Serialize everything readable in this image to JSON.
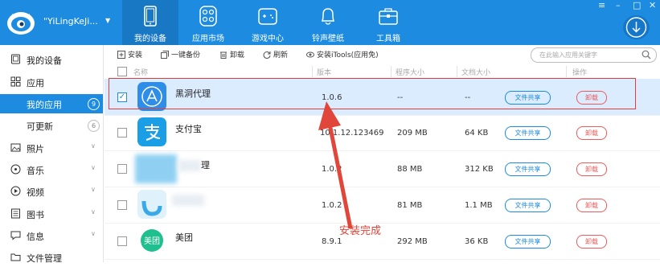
{
  "header": {
    "username": "\"YiLingKeJi...",
    "nav": [
      {
        "label": "我的设备",
        "icon": "tablet-icon",
        "active": true
      },
      {
        "label": "应用市场",
        "icon": "apps-grid-icon",
        "active": false
      },
      {
        "label": "游戏中心",
        "icon": "gamepad-icon",
        "active": false
      },
      {
        "label": "铃声壁纸",
        "icon": "bell-icon",
        "active": false
      },
      {
        "label": "工具箱",
        "icon": "toolbox-icon",
        "active": false
      }
    ],
    "window_controls": {
      "menu": "≡",
      "minimize": "–",
      "maximize": "□",
      "close": "✕"
    }
  },
  "toolbar": {
    "install": "安装",
    "backup": "一键备份",
    "uninstall": "卸载",
    "refresh": "刷新",
    "install_itools": "安装iTools(应用免)",
    "search_placeholder": "在此输入应用关键字"
  },
  "sidebar": {
    "items": [
      {
        "label": "我的设备",
        "icon": "device-icon"
      },
      {
        "label": "应用",
        "icon": "apps-icon"
      },
      {
        "label": "我的应用",
        "badge": "9",
        "active": true
      },
      {
        "label": "可更新",
        "badge": "6"
      },
      {
        "label": "照片",
        "icon": "photo-icon"
      },
      {
        "label": "音乐",
        "icon": "music-icon"
      },
      {
        "label": "视频",
        "icon": "video-icon"
      },
      {
        "label": "图书",
        "icon": "book-icon"
      },
      {
        "label": "信息",
        "icon": "message-icon"
      },
      {
        "label": "文件管理",
        "icon": "folder-icon"
      }
    ]
  },
  "table": {
    "columns": {
      "name": "名称",
      "version": "版本",
      "program_size": "程序大小",
      "doc_size": "文档大小",
      "action": "操作"
    },
    "share_label": "文件共享",
    "uninstall_label": "卸载",
    "rows": [
      {
        "name": "黑洞代理",
        "version": "1.0.6",
        "program_size": "--",
        "doc_size": "--",
        "selected": true
      },
      {
        "name": "支付宝",
        "version": "10.1.12.123469",
        "program_size": "209 MB",
        "doc_size": "64 KB",
        "selected": false
      },
      {
        "name": "理",
        "version": "1.0.2",
        "program_size": "88 MB",
        "doc_size": "312 KB",
        "selected": false
      },
      {
        "name": "",
        "version": "1.0.2",
        "program_size": "81 MB",
        "doc_size": "1.1 MB",
        "selected": false
      },
      {
        "name": "美团",
        "version": "8.9.1",
        "program_size": "292 MB",
        "doc_size": "36 KB",
        "selected": false
      }
    ]
  },
  "annotation": {
    "text": "安装完成",
    "color": "#e0463a"
  },
  "colors": {
    "brand": "#1d8ce0",
    "selected_row": "#dcecff",
    "danger": "#f05a5a"
  }
}
